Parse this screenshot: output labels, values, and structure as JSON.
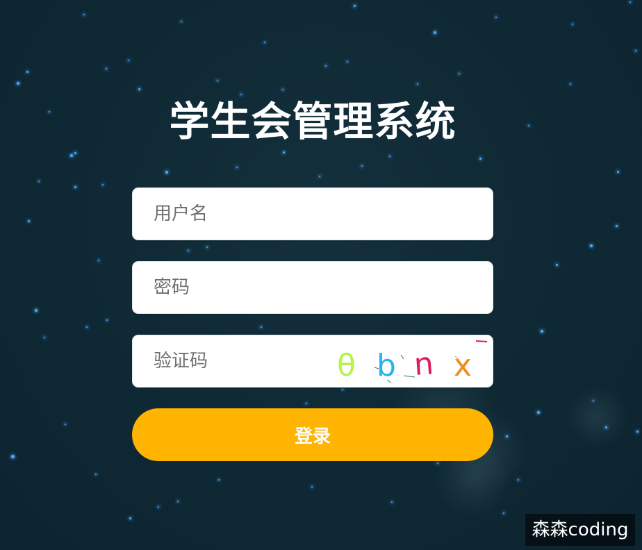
{
  "page": {
    "title": "学生会管理系统"
  },
  "form": {
    "username_placeholder": "用户名",
    "password_placeholder": "密码",
    "captcha_placeholder": "验证码",
    "login_label": "登录"
  },
  "captcha": {
    "chars": [
      {
        "char": "θ",
        "color": "#b6f24a"
      },
      {
        "char": "b",
        "color": "#22b6ee"
      },
      {
        "char": "n",
        "color": "#e0185a"
      },
      {
        "char": "x",
        "color": "#f08c1e"
      }
    ]
  },
  "watermark": {
    "text": "森森coding"
  },
  "colors": {
    "background": "#0f2a35",
    "star": "#4ea8ff",
    "button": "#feb400",
    "field": "#ffffff"
  }
}
